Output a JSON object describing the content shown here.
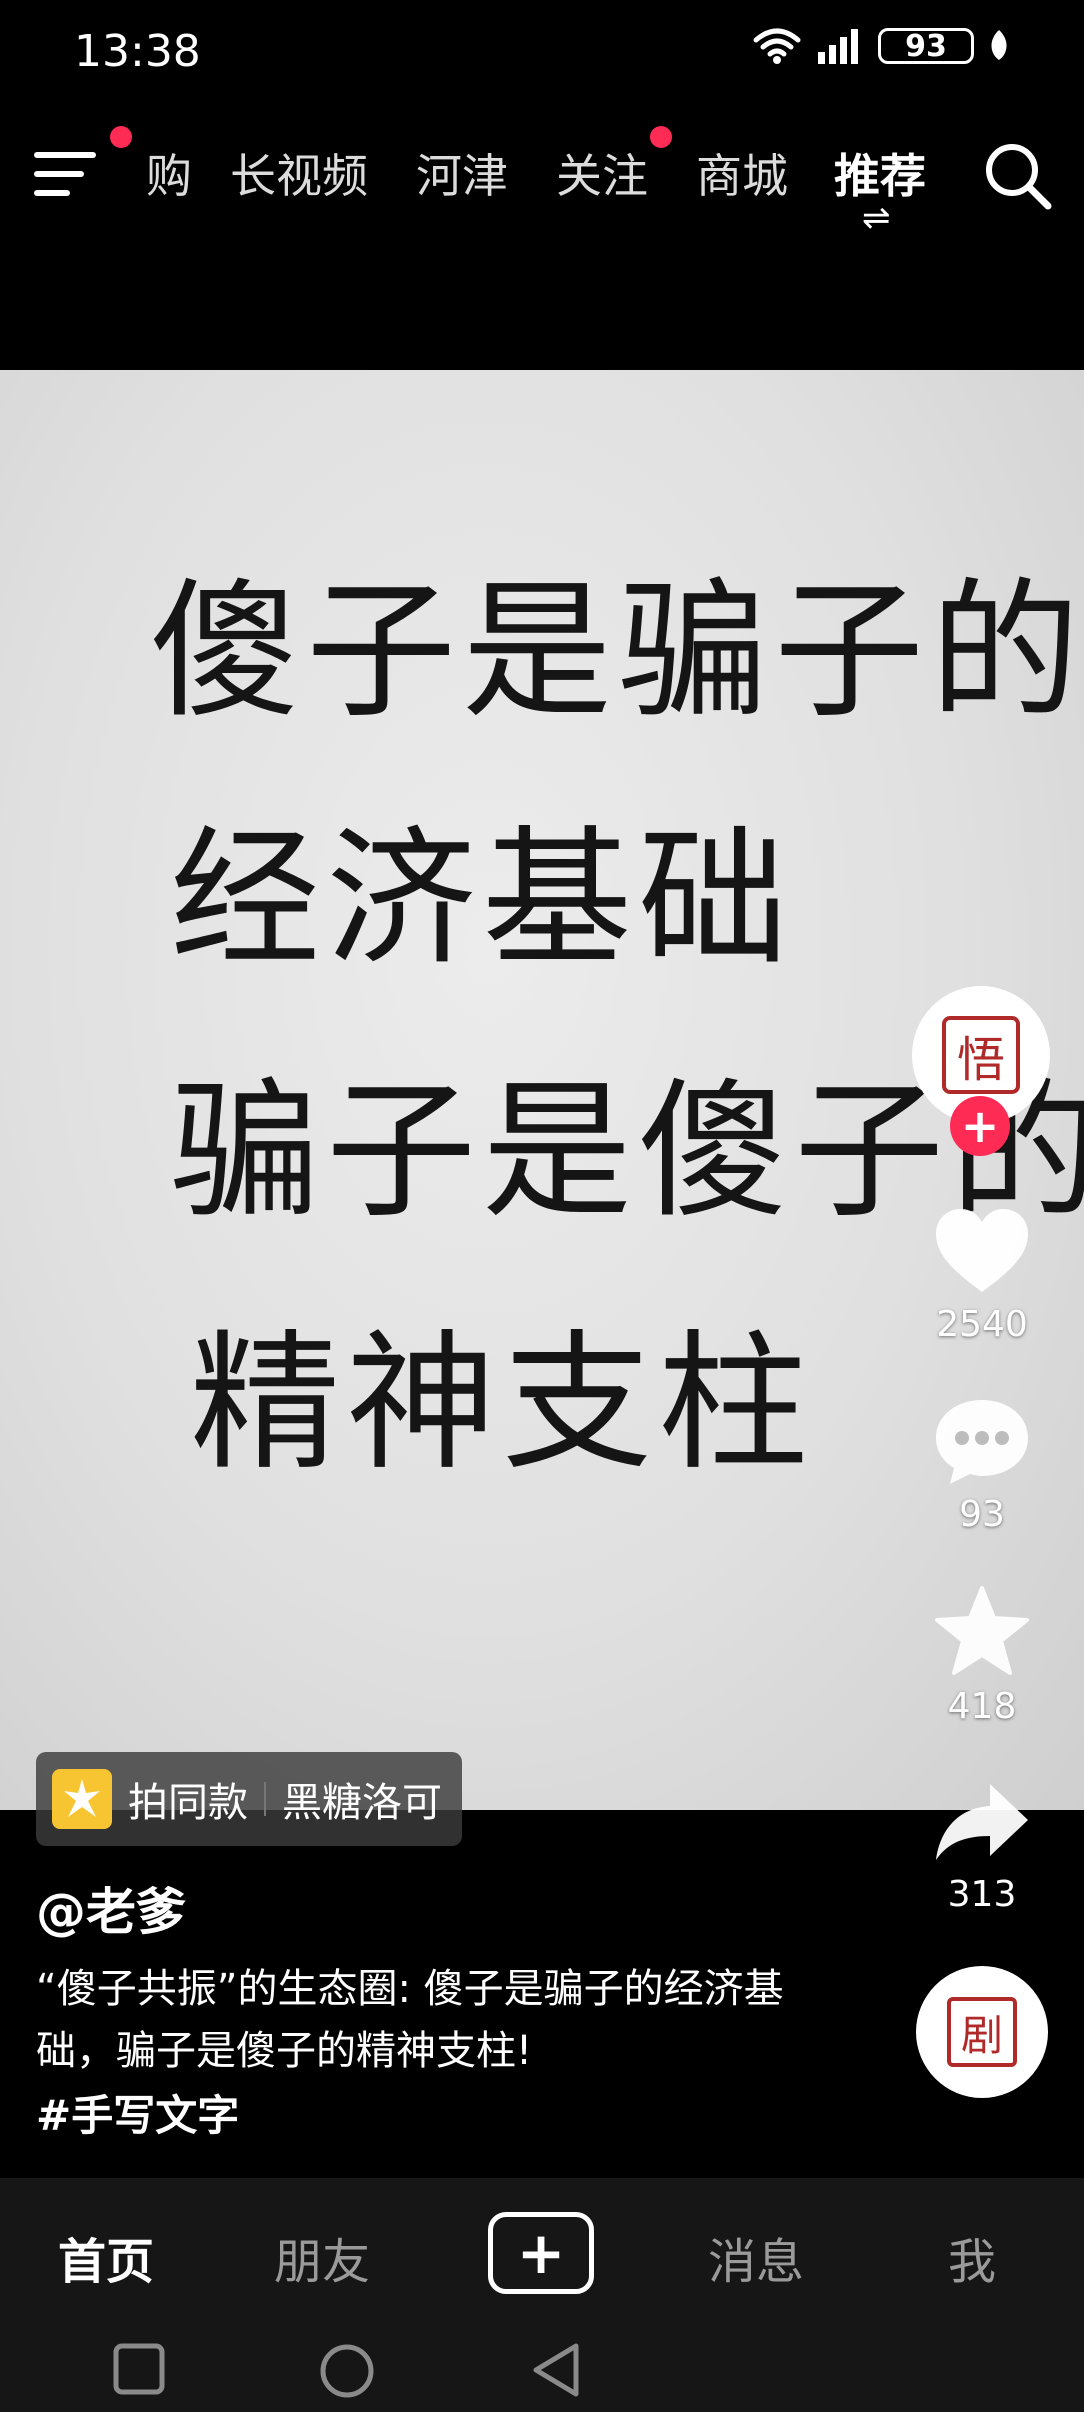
{
  "status_bar": {
    "time": "13:38",
    "battery": "93",
    "icons": [
      "wifi-icon",
      "signal-icon",
      "battery-icon",
      "leaf-icon"
    ]
  },
  "top_nav": {
    "menu_icon": "menu-icon",
    "tabs": [
      {
        "label": "购",
        "badge": false
      },
      {
        "label": "长视频",
        "badge": false
      },
      {
        "label": "河津",
        "badge": false
      },
      {
        "label": "关注",
        "badge": true
      },
      {
        "label": "商城",
        "badge": false
      },
      {
        "label": "推荐",
        "active": true
      }
    ],
    "switch_glyph": "⇌",
    "search_icon": "search-icon"
  },
  "video": {
    "calligraphy_lines": [
      "傻子是骗子的",
      "经济基础",
      "骗子是傻子的",
      "精神支柱"
    ]
  },
  "actions": {
    "avatar_seal_char": "悟",
    "follow_plus": "+",
    "like_count": "2540",
    "comment_count": "93",
    "favorite_count": "418",
    "share_count": "313",
    "music_seal_char": "剧"
  },
  "template_chip": {
    "action": "拍同款",
    "name": "黑糖洛可"
  },
  "author": "@老爹",
  "caption": "“傻子共振”的生态圈: 傻子是骗子的经济基础，骗子是傻子的精神支柱!",
  "hashtag": "#手写文字",
  "bottom_tabs": [
    {
      "label": "首页",
      "active": true
    },
    {
      "label": "朋友"
    },
    {
      "label": "+"
    },
    {
      "label": "消息"
    },
    {
      "label": "我"
    }
  ],
  "colors": {
    "accent": "#fe2c55",
    "chip_yellow": "#f7c531",
    "seal_red": "#b02a2a"
  }
}
